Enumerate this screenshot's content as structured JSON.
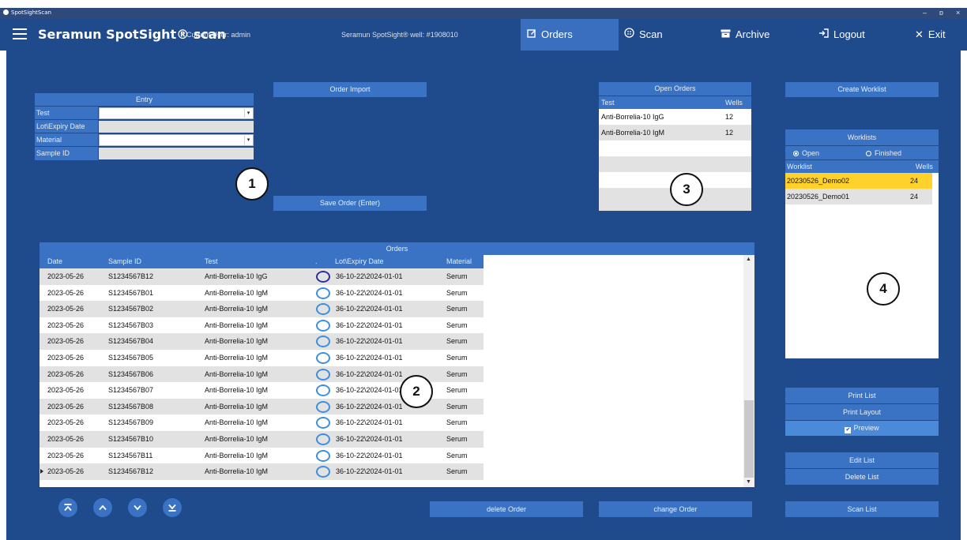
{
  "window": {
    "title": "SpotSightScan",
    "controls": [
      "–",
      "ɒ",
      "×"
    ]
  },
  "header": {
    "app_title": "Seramun SpotSight® scan",
    "current_user": "Current User: admin",
    "well_info": "Seramun SpotSight® well: #1908010",
    "nav": [
      {
        "label": "Orders",
        "icon": "edit-icon",
        "active": true
      },
      {
        "label": "Scan",
        "icon": "scan-icon",
        "active": false
      },
      {
        "label": "Archive",
        "icon": "archive-icon",
        "active": false
      },
      {
        "label": "Logout",
        "icon": "logout-icon",
        "active": false
      },
      {
        "label": "Exit",
        "icon": "close-icon",
        "active": false
      }
    ]
  },
  "entry": {
    "title": "Entry",
    "fields": [
      {
        "label": "Test",
        "value": "",
        "type": "select"
      },
      {
        "label": "Lot\\Expiry Date",
        "value": "",
        "type": "readonly"
      },
      {
        "label": "Material",
        "value": "",
        "type": "select"
      },
      {
        "label": "Sample ID",
        "value": "",
        "type": "readonly"
      }
    ]
  },
  "buttons": {
    "order_import": "Order Import",
    "save_order": "Save Order (Enter)",
    "create_worklist": "Create Worklist",
    "print_list": "Print List",
    "print_layout": "Print Layout",
    "preview": "Preview",
    "edit_list": "Edit List",
    "delete_list": "Delete List",
    "scan_list": "Scan List",
    "delete_order": "delete Order",
    "change_order": "change Order"
  },
  "open_orders": {
    "title": "Open Orders",
    "columns": [
      "Test",
      "Wells"
    ],
    "rows": [
      {
        "test": "Anti-Borrelia-10 IgG",
        "wells": "12"
      },
      {
        "test": "Anti-Borrelia-10 IgM",
        "wells": "12"
      }
    ]
  },
  "worklists": {
    "title": "Worklists",
    "radio_open": "Open",
    "radio_finished": "Finished",
    "columns": [
      "Worklist",
      "Wells"
    ],
    "rows": [
      {
        "name": "20230526_Demo02",
        "wells": "24",
        "selected": true
      },
      {
        "name": "20230526_Demo01",
        "wells": "24",
        "selected": false
      }
    ]
  },
  "orders": {
    "title": "Orders",
    "columns": [
      "Date",
      "Sample ID",
      "Test",
      ".",
      "Lot\\Expiry Date",
      "Material"
    ],
    "rows": [
      {
        "date": "2023-05-26",
        "sample_id": "S1234567B12",
        "test": "Anti-Borrelia-10 IgG",
        "lot": "36-10-22\\2024-01-01",
        "material": "Serum"
      },
      {
        "date": "2023-05-26",
        "sample_id": "S1234567B01",
        "test": "Anti-Borrelia-10 IgM",
        "lot": "36-10-22\\2024-01-01",
        "material": "Serum"
      },
      {
        "date": "2023-05-26",
        "sample_id": "S1234567B02",
        "test": "Anti-Borrelia-10 IgM",
        "lot": "36-10-22\\2024-01-01",
        "material": "Serum"
      },
      {
        "date": "2023-05-26",
        "sample_id": "S1234567B03",
        "test": "Anti-Borrelia-10 IgM",
        "lot": "36-10-22\\2024-01-01",
        "material": "Serum"
      },
      {
        "date": "2023-05-26",
        "sample_id": "S1234567B04",
        "test": "Anti-Borrelia-10 IgM",
        "lot": "36-10-22\\2024-01-01",
        "material": "Serum"
      },
      {
        "date": "2023-05-26",
        "sample_id": "S1234567B05",
        "test": "Anti-Borrelia-10 IgM",
        "lot": "36-10-22\\2024-01-01",
        "material": "Serum"
      },
      {
        "date": "2023-05-26",
        "sample_id": "S1234567B06",
        "test": "Anti-Borrelia-10 IgM",
        "lot": "36-10-22\\2024-01-01",
        "material": "Serum"
      },
      {
        "date": "2023-05-26",
        "sample_id": "S1234567B07",
        "test": "Anti-Borrelia-10 IgM",
        "lot": "36-10-22\\2024-01-01",
        "material": "Serum"
      },
      {
        "date": "2023-05-26",
        "sample_id": "S1234567B08",
        "test": "Anti-Borrelia-10 IgM",
        "lot": "36-10-22\\2024-01-01",
        "material": "Serum"
      },
      {
        "date": "2023-05-26",
        "sample_id": "S1234567B09",
        "test": "Anti-Borrelia-10 IgM",
        "lot": "36-10-22\\2024-01-01",
        "material": "Serum"
      },
      {
        "date": "2023-05-26",
        "sample_id": "S1234567B10",
        "test": "Anti-Borrelia-10 IgM",
        "lot": "36-10-22\\2024-01-01",
        "material": "Serum"
      },
      {
        "date": "2023-05-26",
        "sample_id": "S1234567B11",
        "test": "Anti-Borrelia-10 IgM",
        "lot": "36-10-22\\2024-01-01",
        "material": "Serum"
      },
      {
        "date": "2023-05-26",
        "sample_id": "S1234567B12",
        "test": "Anti-Borrelia-10 IgM",
        "lot": "36-10-22\\2024-01-01",
        "material": "Serum"
      }
    ]
  },
  "callouts": [
    "1",
    "2",
    "3",
    "4"
  ],
  "colors": {
    "background": "#1f4a8c",
    "panel": "#3b73c4",
    "selected_row": "#ffd22b",
    "ring": "#3a8fe0"
  }
}
